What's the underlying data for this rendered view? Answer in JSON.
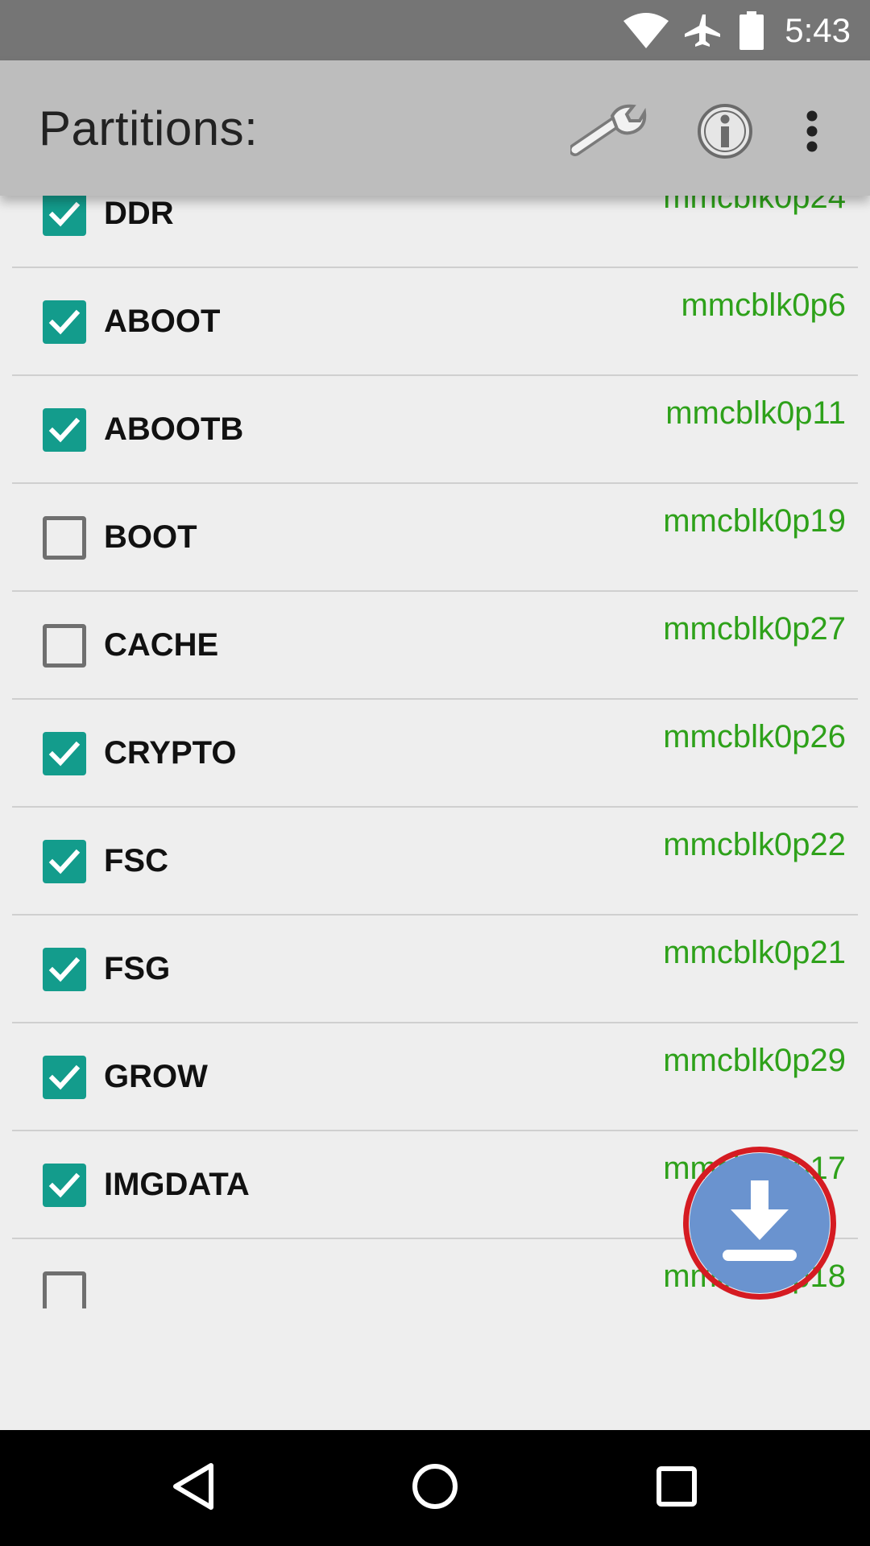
{
  "status_bar": {
    "time": "5:43",
    "icons": [
      "wifi-icon",
      "airplane-mode-icon",
      "battery-icon"
    ]
  },
  "app_bar": {
    "title": "Partitions:",
    "actions": [
      "wrench-icon",
      "info-icon",
      "overflow-menu-icon"
    ]
  },
  "partitions": [
    {
      "name": "DDR",
      "device": "mmcblk0p24",
      "checked": true
    },
    {
      "name": "ABOOT",
      "device": "mmcblk0p6",
      "checked": true
    },
    {
      "name": "ABOOTB",
      "device": "mmcblk0p11",
      "checked": true
    },
    {
      "name": "BOOT",
      "device": "mmcblk0p19",
      "checked": false
    },
    {
      "name": "CACHE",
      "device": "mmcblk0p27",
      "checked": false
    },
    {
      "name": "CRYPTO",
      "device": "mmcblk0p26",
      "checked": true
    },
    {
      "name": "FSC",
      "device": "mmcblk0p22",
      "checked": true
    },
    {
      "name": "FSG",
      "device": "mmcblk0p21",
      "checked": true
    },
    {
      "name": "GROW",
      "device": "mmcblk0p29",
      "checked": true
    },
    {
      "name": "IMGDATA",
      "device": "mmcblk0p17",
      "checked": true
    },
    {
      "name": "",
      "device": "mmcblk0p18",
      "checked": false
    }
  ],
  "fab": {
    "icon": "download-icon"
  },
  "nav_bar": {
    "buttons": [
      "back-icon",
      "home-icon",
      "recents-icon"
    ]
  },
  "colors": {
    "accent": "#139c8c",
    "device_text": "#2ea11a",
    "fab": "#6a93cf",
    "highlight_ring": "#d51b22"
  }
}
